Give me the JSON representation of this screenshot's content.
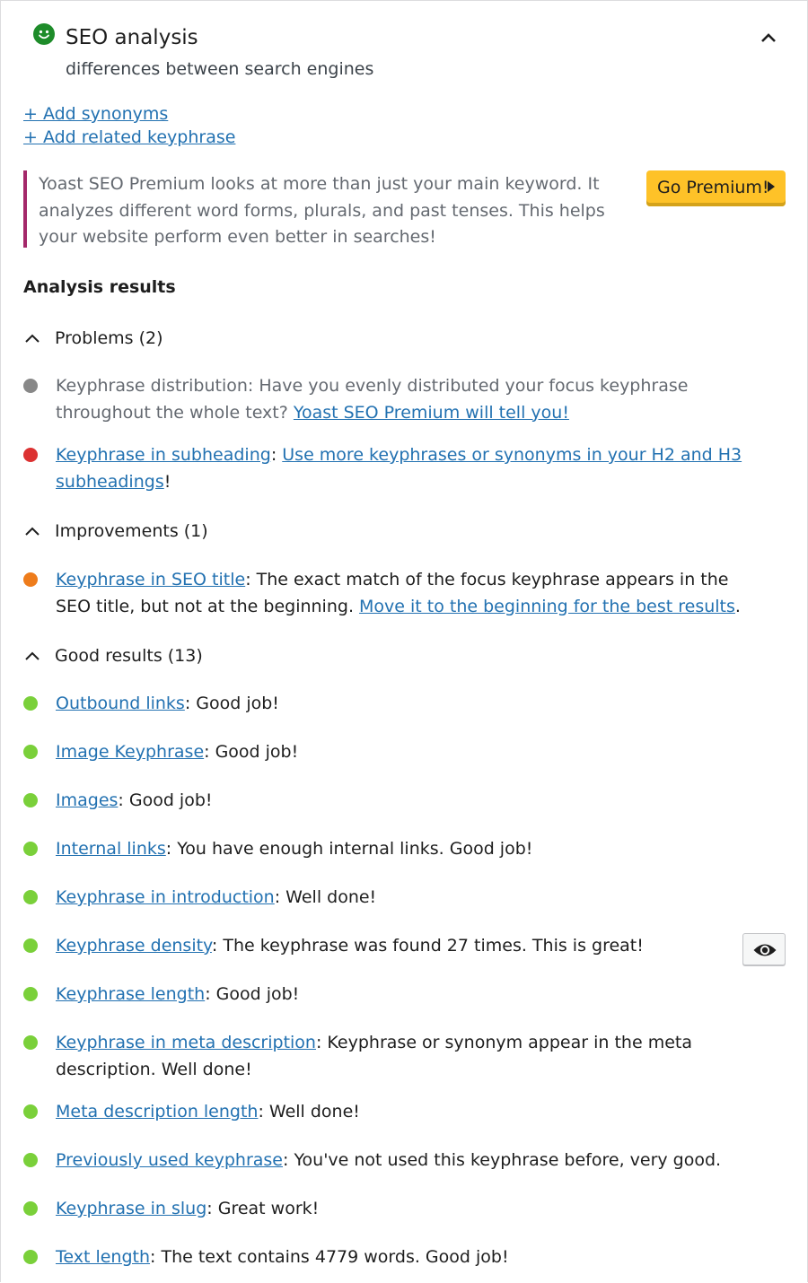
{
  "header": {
    "title": "SEO analysis",
    "keyphrase": "differences between search engines",
    "status_color": "#1e8c2a"
  },
  "links": {
    "add_synonyms": "+ Add synonyms",
    "add_related": "+ Add related keyphrase"
  },
  "premium": {
    "text": "Yoast SEO Premium looks at more than just your main keyword. It analyzes different word forms, plurals, and past tenses. This helps your website perform even better in searches!",
    "button_label": "Go Premium!",
    "accent": "#a4286a",
    "button_color": "#fec228"
  },
  "analysis_heading": "Analysis results",
  "colors": {
    "gray": "#888888",
    "red": "#dc3232",
    "orange": "#ee7c1b",
    "green": "#7ad03a"
  },
  "problems": {
    "heading": "Problems (2)",
    "items": [
      {
        "text_before": "Keyphrase distribution: Have you evenly distributed your focus keyphrase throughout the whole text? ",
        "link": "Yoast SEO Premium will tell you!",
        "color": "gray"
      },
      {
        "title": "Keyphrase in subheading",
        "sep": ": ",
        "link": "Use more keyphrases or synonyms in your H2 and H3 subheadings",
        "after": "!",
        "color": "red"
      }
    ]
  },
  "improvements": {
    "heading": "Improvements (1)",
    "items": [
      {
        "title": "Keyphrase in SEO title",
        "text": ": The exact match of the focus keyphrase appears in the SEO title, but not at the beginning. ",
        "link": "Move it to the beginning for the best results",
        "after": ".",
        "color": "orange"
      }
    ]
  },
  "good": {
    "heading": "Good results (13)",
    "items": [
      {
        "title": "Outbound links",
        "text": ": Good job!"
      },
      {
        "title": "Image Keyphrase",
        "text": ": Good job!"
      },
      {
        "title": "Images",
        "text": ": Good job!"
      },
      {
        "title": "Internal links",
        "text": ": You have enough internal links. Good job!"
      },
      {
        "title": "Keyphrase in introduction",
        "text": ": Well done!"
      },
      {
        "title": "Keyphrase density",
        "text": ": The keyphrase was found 27 times. This is great!"
      },
      {
        "title": "Keyphrase length",
        "text": ": Good job!"
      },
      {
        "title": "Keyphrase in meta description",
        "text": ": Keyphrase or synonym appear in the meta description. Well done!"
      },
      {
        "title": "Meta description length",
        "text": ": Well done!"
      },
      {
        "title": "Previously used keyphrase",
        "text": ": You've not used this keyphrase before, very good."
      },
      {
        "title": "Keyphrase in slug",
        "text": ": Great work!"
      },
      {
        "title": "Text length",
        "text": ": The text contains 4779 words. Good job!"
      }
    ]
  }
}
